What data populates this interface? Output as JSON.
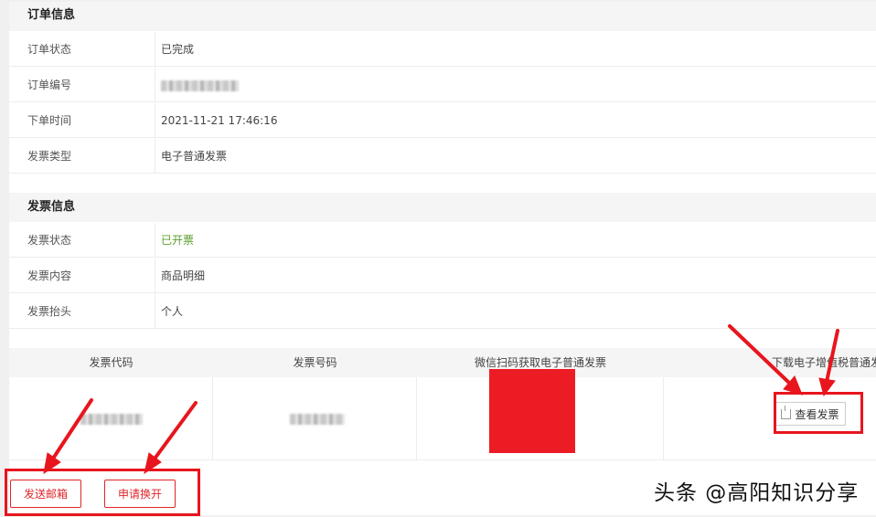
{
  "order_section": {
    "title": "订单信息",
    "rows": [
      {
        "label": "订单状态",
        "value": "已完成"
      },
      {
        "label": "订单编号",
        "value": ""
      },
      {
        "label": "下单时间",
        "value": "2021-11-21 17:46:16"
      },
      {
        "label": "发票类型",
        "value": "电子普通发票"
      }
    ]
  },
  "invoice_section": {
    "title": "发票信息",
    "rows": [
      {
        "label": "发票状态",
        "value": "已开票"
      },
      {
        "label": "发票内容",
        "value": "商品明细"
      },
      {
        "label": "发票抬头",
        "value": "个人"
      }
    ]
  },
  "invoice_table": {
    "headers": [
      "发票代码",
      "发票号码",
      "微信扫码获取电子普通发票",
      "下载电子增值税普通发票"
    ],
    "view_button": "查看发票"
  },
  "actions": {
    "send_email": "发送邮箱",
    "apply_reissue": "申请换开"
  },
  "watermark": "头条 @高阳知识分享",
  "colors": {
    "accent_red": "#e0252a",
    "status_green": "#5a9e2c",
    "qr_placeholder": "#ec1c24"
  }
}
